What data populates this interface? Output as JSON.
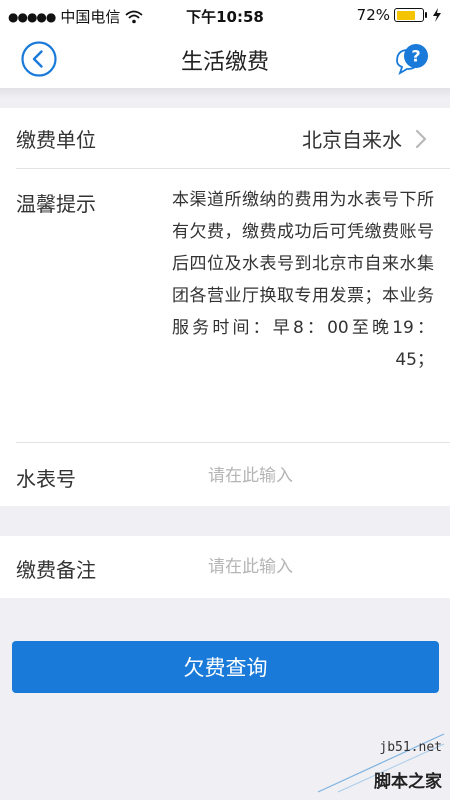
{
  "status_bar": {
    "signal": "●●●●●",
    "carrier": "中国电信",
    "time": "下午10:58",
    "battery_percent": "72%",
    "battery_level": 0.72
  },
  "nav": {
    "title": "生活缴费",
    "help_glyph": "?"
  },
  "form": {
    "unit_label": "缴费单位",
    "unit_value": "北京自来水",
    "tip_label": "温馨提示",
    "tip_text": "本渠道所缴纳的费用为水表号下所有欠费，缴费成功后可凭缴费账号后四位及水表号到北京市自来水集团各营业厅换取专用发票；本业务服务时间：早8：00至晚19：45；",
    "meter_label": "水表号",
    "meter_placeholder": "请在此输入",
    "remark_label": "缴费备注",
    "remark_placeholder": "请在此输入"
  },
  "actions": {
    "query_label": "欠费查询"
  },
  "watermark": {
    "site": "jb51.net",
    "name": "脚本之家"
  },
  "colors": {
    "accent": "#1a7ad9",
    "background": "#efeff4",
    "battery": "#f5c400"
  }
}
